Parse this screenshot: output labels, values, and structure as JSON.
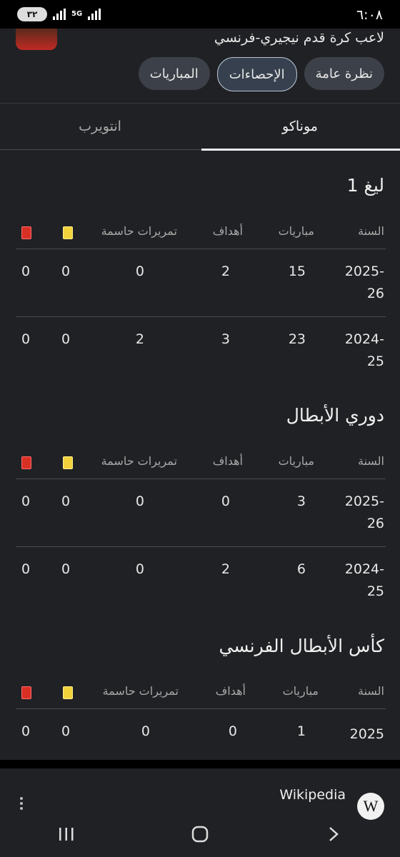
{
  "status_bar": {
    "time": "٦:٠٨",
    "battery": "٣٢",
    "network": "5G"
  },
  "header": {
    "subtitle": "لاعب كرة قدم نيجيري-فرنسي",
    "chips": [
      {
        "label": "نظرة عامة",
        "active": false
      },
      {
        "label": "الإحصاءات",
        "active": true
      },
      {
        "label": "المباريات",
        "active": false
      }
    ]
  },
  "team_tabs": [
    {
      "label": "موناكو",
      "selected": true
    },
    {
      "label": "انتويرب",
      "selected": false
    }
  ],
  "columns": {
    "year": "السنة",
    "matches": "مباريات",
    "goals": "أهداف",
    "assists": "تمريرات حاسمة",
    "yellow_icon": "yellow-card-icon",
    "red_icon": "red-card-icon"
  },
  "competitions": [
    {
      "title": "ليغ 1",
      "rows": [
        {
          "year": "2025-26",
          "matches": "15",
          "goals": "2",
          "assists": "0",
          "yellow": "0",
          "red": "0"
        },
        {
          "year": "2024-25",
          "matches": "23",
          "goals": "3",
          "assists": "2",
          "yellow": "0",
          "red": "0"
        }
      ]
    },
    {
      "title": "دوري الأبطال",
      "rows": [
        {
          "year": "2025-26",
          "matches": "3",
          "goals": "0",
          "assists": "0",
          "yellow": "0",
          "red": "0"
        },
        {
          "year": "2024-25",
          "matches": "6",
          "goals": "2",
          "assists": "0",
          "yellow": "0",
          "red": "0"
        }
      ]
    },
    {
      "title": "كأس الأبطال الفرنسي",
      "rows": [
        {
          "year": "2025",
          "matches": "1",
          "goals": "0",
          "assists": "0",
          "yellow": "0",
          "red": "0"
        }
      ]
    }
  ],
  "source": {
    "label": "Wikipedia",
    "logo": "W"
  },
  "colors": {
    "background": "#202124",
    "chip_active_border": "#b8c4d6",
    "red_card": "#d93025",
    "yellow_card": "#f2d23c"
  }
}
